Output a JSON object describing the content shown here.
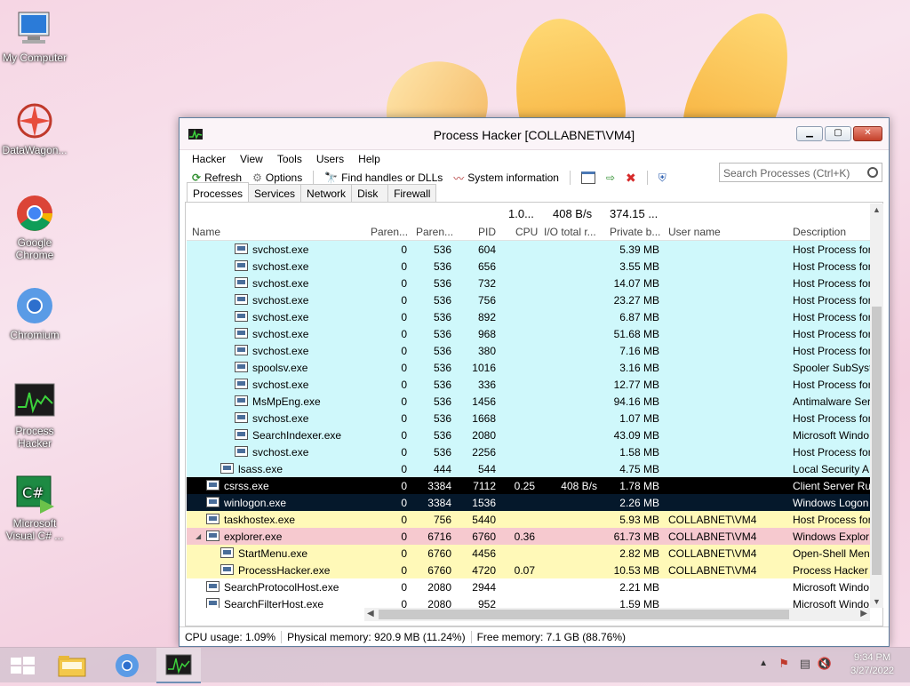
{
  "desktop": {
    "icons": [
      {
        "label": "My Computer"
      },
      {
        "label": "DataWagon..."
      },
      {
        "label": "Google Chrome"
      },
      {
        "label": "Chromium"
      },
      {
        "label": "Process Hacker"
      },
      {
        "label": "Microsoft Visual C# ..."
      }
    ]
  },
  "window": {
    "title": "Process Hacker [COLLABNET\\VM4]",
    "menu": [
      "Hacker",
      "View",
      "Tools",
      "Users",
      "Help"
    ],
    "toolbar": {
      "refresh": "Refresh",
      "options": "Options",
      "find_handles": "Find handles or DLLs",
      "system_info": "System information"
    },
    "search_placeholder": "Search Processes (Ctrl+K)",
    "tabs": [
      "Processes",
      "Services",
      "Network",
      "Disk",
      "Firewall"
    ],
    "totals": {
      "cpu": "1.0...",
      "io": "408 B/s",
      "private": "374.15 ..."
    },
    "columns": {
      "name": "Name",
      "parent1": "Paren...",
      "parent2": "Paren...",
      "pid": "PID",
      "cpu": "CPU",
      "io": "I/O total r...",
      "private": "Private b...",
      "user": "User name",
      "desc": "Description"
    },
    "rows": [
      {
        "name": "svchost.exe",
        "p1": "0",
        "p2": "536",
        "pid": "604",
        "cpu": "",
        "io": "",
        "priv": "5.39 MB",
        "user": "",
        "desc": "Host Process for",
        "style": "service",
        "indent": 3
      },
      {
        "name": "svchost.exe",
        "p1": "0",
        "p2": "536",
        "pid": "656",
        "cpu": "",
        "io": "",
        "priv": "3.55 MB",
        "user": "",
        "desc": "Host Process for",
        "style": "service",
        "indent": 3
      },
      {
        "name": "svchost.exe",
        "p1": "0",
        "p2": "536",
        "pid": "732",
        "cpu": "",
        "io": "",
        "priv": "14.07 MB",
        "user": "",
        "desc": "Host Process for",
        "style": "service",
        "indent": 3
      },
      {
        "name": "svchost.exe",
        "p1": "0",
        "p2": "536",
        "pid": "756",
        "cpu": "",
        "io": "",
        "priv": "23.27 MB",
        "user": "",
        "desc": "Host Process for",
        "style": "service",
        "indent": 3
      },
      {
        "name": "svchost.exe",
        "p1": "0",
        "p2": "536",
        "pid": "892",
        "cpu": "",
        "io": "",
        "priv": "6.87 MB",
        "user": "",
        "desc": "Host Process for",
        "style": "service",
        "indent": 3
      },
      {
        "name": "svchost.exe",
        "p1": "0",
        "p2": "536",
        "pid": "968",
        "cpu": "",
        "io": "",
        "priv": "51.68 MB",
        "user": "",
        "desc": "Host Process for",
        "style": "service",
        "indent": 3
      },
      {
        "name": "svchost.exe",
        "p1": "0",
        "p2": "536",
        "pid": "380",
        "cpu": "",
        "io": "",
        "priv": "7.16 MB",
        "user": "",
        "desc": "Host Process for",
        "style": "service",
        "indent": 3
      },
      {
        "name": "spoolsv.exe",
        "p1": "0",
        "p2": "536",
        "pid": "1016",
        "cpu": "",
        "io": "",
        "priv": "3.16 MB",
        "user": "",
        "desc": "Spooler SubSyst",
        "style": "service",
        "indent": 3
      },
      {
        "name": "svchost.exe",
        "p1": "0",
        "p2": "536",
        "pid": "336",
        "cpu": "",
        "io": "",
        "priv": "12.77 MB",
        "user": "",
        "desc": "Host Process for",
        "style": "service",
        "indent": 3
      },
      {
        "name": "MsMpEng.exe",
        "p1": "0",
        "p2": "536",
        "pid": "1456",
        "cpu": "",
        "io": "",
        "priv": "94.16 MB",
        "user": "",
        "desc": "Antimalware Ser",
        "style": "service",
        "indent": 3
      },
      {
        "name": "svchost.exe",
        "p1": "0",
        "p2": "536",
        "pid": "1668",
        "cpu": "",
        "io": "",
        "priv": "1.07 MB",
        "user": "",
        "desc": "Host Process for",
        "style": "service",
        "indent": 3
      },
      {
        "name": "SearchIndexer.exe",
        "p1": "0",
        "p2": "536",
        "pid": "2080",
        "cpu": "",
        "io": "",
        "priv": "43.09 MB",
        "user": "",
        "desc": "Microsoft Windo",
        "style": "service",
        "indent": 3
      },
      {
        "name": "svchost.exe",
        "p1": "0",
        "p2": "536",
        "pid": "2256",
        "cpu": "",
        "io": "",
        "priv": "1.58 MB",
        "user": "",
        "desc": "Host Process for",
        "style": "service",
        "indent": 3
      },
      {
        "name": "lsass.exe",
        "p1": "0",
        "p2": "444",
        "pid": "544",
        "cpu": "",
        "io": "",
        "priv": "4.75 MB",
        "user": "",
        "desc": "Local Security A",
        "style": "service",
        "indent": 2
      },
      {
        "name": "csrss.exe",
        "p1": "0",
        "p2": "3384",
        "pid": "7112",
        "cpu": "0.25",
        "io": "408 B/s",
        "priv": "1.78 MB",
        "user": "",
        "desc": "Client Server Ru",
        "style": "dark",
        "indent": 1
      },
      {
        "name": "winlogon.exe",
        "p1": "0",
        "p2": "3384",
        "pid": "1536",
        "cpu": "",
        "io": "",
        "priv": "2.26 MB",
        "user": "",
        "desc": "Windows Logon",
        "style": "dark2",
        "indent": 1
      },
      {
        "name": "taskhostex.exe",
        "p1": "0",
        "p2": "756",
        "pid": "5440",
        "cpu": "",
        "io": "",
        "priv": "5.93 MB",
        "user": "COLLABNET\\VM4",
        "desc": "Host Process for",
        "style": "user",
        "indent": 1
      },
      {
        "name": "explorer.exe",
        "p1": "0",
        "p2": "6716",
        "pid": "6760",
        "cpu": "0.36",
        "io": "",
        "priv": "61.73 MB",
        "user": "COLLABNET\\VM4",
        "desc": "Windows Explor",
        "style": "explorer",
        "indent": 1
      },
      {
        "name": "StartMenu.exe",
        "p1": "0",
        "p2": "6760",
        "pid": "4456",
        "cpu": "",
        "io": "",
        "priv": "2.82 MB",
        "user": "COLLABNET\\VM4",
        "desc": "Open-Shell Men",
        "style": "user",
        "indent": 2
      },
      {
        "name": "ProcessHacker.exe",
        "p1": "0",
        "p2": "6760",
        "pid": "4720",
        "cpu": "0.07",
        "io": "",
        "priv": "10.53 MB",
        "user": "COLLABNET\\VM4",
        "desc": "Process Hacker",
        "style": "user",
        "indent": 2
      },
      {
        "name": "SearchProtocolHost.exe",
        "p1": "0",
        "p2": "2080",
        "pid": "2944",
        "cpu": "",
        "io": "",
        "priv": "2.21 MB",
        "user": "",
        "desc": "Microsoft Windo",
        "style": "plain",
        "indent": 1
      },
      {
        "name": "SearchFilterHost.exe",
        "p1": "0",
        "p2": "2080",
        "pid": "952",
        "cpu": "",
        "io": "",
        "priv": "1.59 MB",
        "user": "",
        "desc": "Microsoft Windo",
        "style": "plain",
        "indent": 1
      }
    ],
    "status": {
      "cpu": "CPU usage: 1.09%",
      "physical": "Physical memory: 920.9 MB (11.24%)",
      "free": "Free memory: 7.1 GB (88.76%)"
    }
  },
  "taskbar": {
    "time": "9:34 PM",
    "date": "3/27/2022"
  }
}
